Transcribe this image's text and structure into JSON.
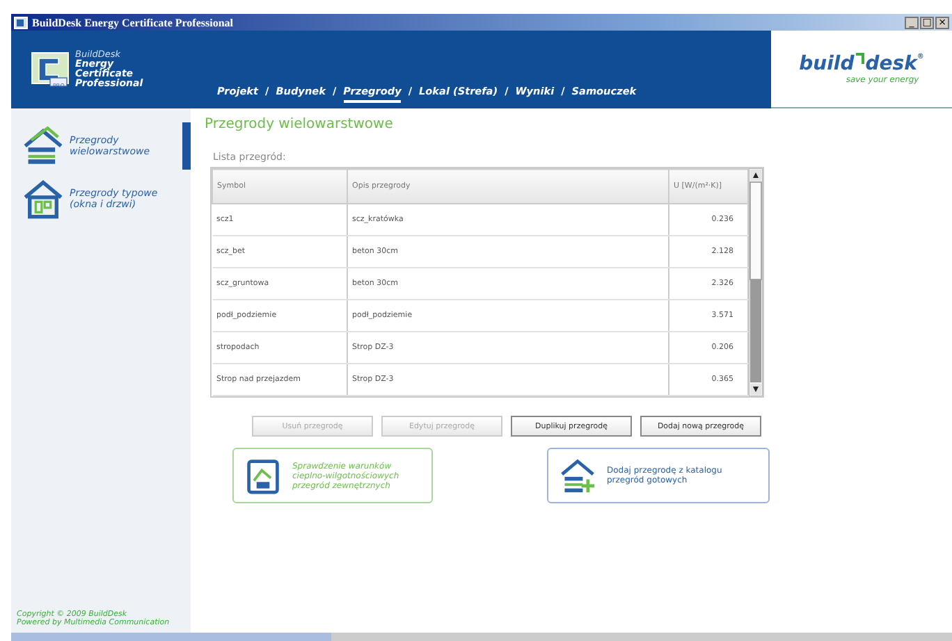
{
  "window": {
    "title": "BuildDesk Energy Certificate Professional",
    "controls": [
      "_",
      "□",
      "×"
    ]
  },
  "product": {
    "brand": "BuildDesk",
    "lines": [
      "Energy",
      "Certificate",
      "Professional"
    ],
    "badge": "PRO"
  },
  "nav": [
    {
      "label": "Projekt",
      "selected": false,
      "separator": "/"
    },
    {
      "label": "Budynek",
      "selected": false,
      "separator": "/"
    },
    {
      "label": "Przegrody",
      "selected": true,
      "separator": "/"
    },
    {
      "label": "Lokal (Strefa)",
      "selected": false,
      "separator": "/"
    },
    {
      "label": "Wyniki",
      "selected": false,
      "separator": "/"
    },
    {
      "label": "Samouczek",
      "selected": false
    }
  ],
  "logo": {
    "left": "build",
    "right": "desk",
    "mark": "®",
    "tagline": "save your energy"
  },
  "sidebar": {
    "items": [
      {
        "label": "Przegrody wielowarstwowe",
        "selected": true
      },
      {
        "label": "Przegrody typowe (okna i drzwi)",
        "selected": false
      }
    ],
    "copyright": [
      "Copyright © 2009 BuildDesk",
      "Powered by Multimedia Communication"
    ]
  },
  "content": {
    "title": "Przegrody wielowarstwowe",
    "list_label": "Lista przegród:"
  },
  "table": {
    "columns": [
      "Symbol",
      "Opis przegrody",
      "U [W/(m²·K)]"
    ],
    "rows": [
      [
        "scz1",
        "scz_kratówka",
        "0.236"
      ],
      [
        "scz_bet",
        "beton 30cm",
        "2.128"
      ],
      [
        "scz_gruntowa",
        "beton 30cm",
        "2.326"
      ],
      [
        "podł_podziemie",
        "podł_podziemie",
        "3.571"
      ],
      [
        "stropodach",
        "Strop DZ-3",
        "0.206"
      ],
      [
        "Strop nad przejazdem",
        "Strop DZ-3",
        "0.365"
      ]
    ]
  },
  "buttons": [
    {
      "label": "Usuń przegrodę",
      "disabled": true
    },
    {
      "label": "Edytuj przegrodę",
      "disabled": true
    },
    {
      "label": "Duplikuj przegrodę",
      "disabled": false
    },
    {
      "label": "Dodaj nową przegrodę",
      "disabled": false
    }
  ],
  "actions": [
    {
      "kind": "check",
      "label": "Sprawdzenie warunków cieplno-wilgotnościowych przegród zewnętrznych"
    },
    {
      "kind": "catalog",
      "label": "Dodaj przegrodę z katalogu przegród gotowych"
    }
  ]
}
